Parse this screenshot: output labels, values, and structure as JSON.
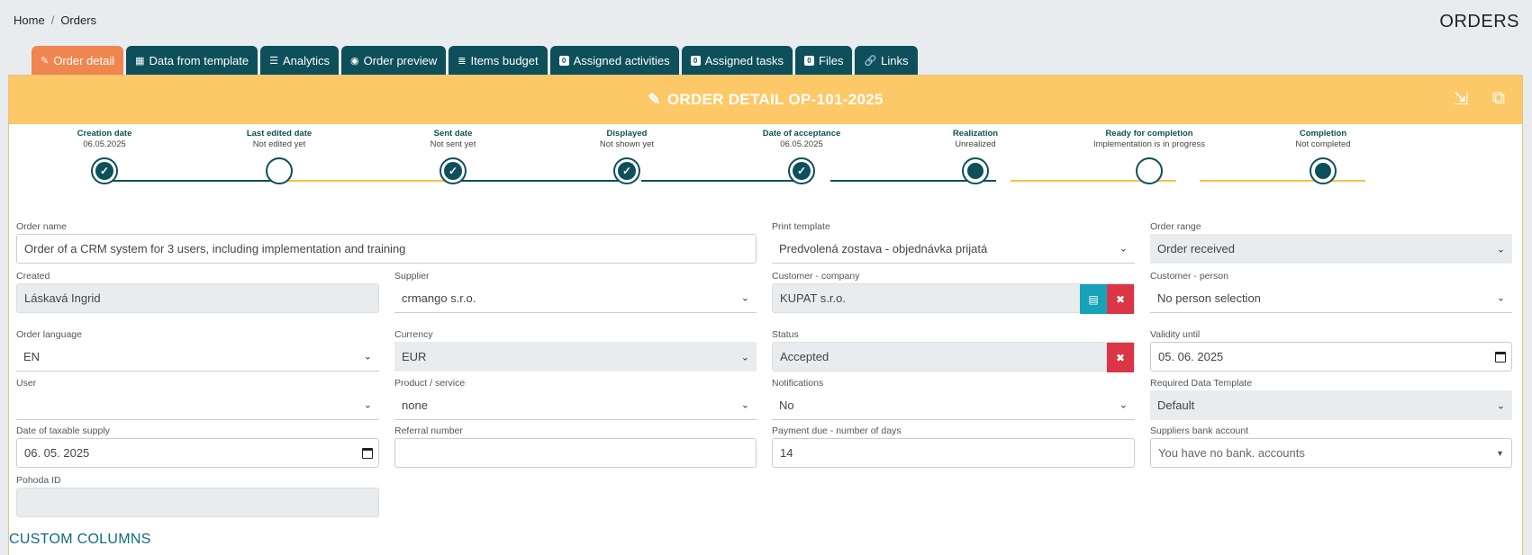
{
  "breadcrumb": {
    "home": "Home",
    "current": "Orders"
  },
  "page_title": "ORDERS",
  "tabs": [
    {
      "label": "Order detail",
      "icon": "edit-icon"
    },
    {
      "label": "Data from template",
      "icon": "table-icon"
    },
    {
      "label": "Analytics",
      "icon": "list-icon"
    },
    {
      "label": "Order preview",
      "icon": "eye-icon"
    },
    {
      "label": "Items budget",
      "icon": "database-icon"
    },
    {
      "label": "Assigned activities",
      "icon": "badge-icon"
    },
    {
      "label": "Assigned tasks",
      "icon": "badge-icon"
    },
    {
      "label": "Files",
      "icon": "badge-icon"
    },
    {
      "label": "Links",
      "icon": "link-icon"
    }
  ],
  "panel": {
    "title": "ORDER DETAIL OP-101-2025"
  },
  "timeline": [
    {
      "title": "Creation date",
      "sub": "06.05.2025",
      "state": "done"
    },
    {
      "title": "Last edited date",
      "sub": "Not edited yet",
      "state": "empty"
    },
    {
      "title": "Sent date",
      "sub": "Not sent yet",
      "state": "done"
    },
    {
      "title": "Displayed",
      "sub": "Not shown yet",
      "state": "done"
    },
    {
      "title": "Date of acceptance",
      "sub": "06.05.2025",
      "state": "done"
    },
    {
      "title": "Realization",
      "sub": "Unrealized",
      "state": "current"
    },
    {
      "title": "Ready for completion",
      "sub": "Implementation is in progress",
      "state": "empty"
    },
    {
      "title": "Completion",
      "sub": "Not completed",
      "state": "current"
    }
  ],
  "form": {
    "order_name": {
      "label": "Order name",
      "value": "Order of a CRM system for 3 users, including implementation and training"
    },
    "print_template": {
      "label": "Print template",
      "value": "Predvolená zostava - objednávka prijatá"
    },
    "order_range": {
      "label": "Order range",
      "value": "Order received"
    },
    "created": {
      "label": "Created",
      "value": "Láskavá Ingrid"
    },
    "supplier": {
      "label": "Supplier",
      "value": "crmango s.r.o."
    },
    "customer_company": {
      "label": "Customer - company",
      "value": "KUPAT s.r.o."
    },
    "customer_person": {
      "label": "Customer - person",
      "value": "No person selection"
    },
    "order_language": {
      "label": "Order language",
      "value": "EN"
    },
    "currency": {
      "label": "Currency",
      "value": "EUR"
    },
    "status": {
      "label": "Status",
      "value": "Accepted"
    },
    "validity_until": {
      "label": "Validity until",
      "value": "05. 06. 2025"
    },
    "user": {
      "label": "User",
      "value": ""
    },
    "product_service": {
      "label": "Product / service",
      "value": "none"
    },
    "notifications": {
      "label": "Notifications",
      "value": "No"
    },
    "required_template": {
      "label": "Required Data Template",
      "value": "Default"
    },
    "taxable_supply": {
      "label": "Date of taxable supply",
      "value": "06. 05. 2025"
    },
    "referral_number": {
      "label": "Referral number",
      "value": ""
    },
    "payment_due": {
      "label": "Payment due - number of days",
      "value": "14"
    },
    "bank_account": {
      "label": "Suppliers bank account",
      "value": "You have no bank. accounts"
    },
    "pohoda_id": {
      "label": "Pohoda ID",
      "value": ""
    }
  },
  "custom_columns": "CUSTOM COLUMNS",
  "colors": {
    "accent": "#f0864f",
    "header": "#fdc867",
    "teal": "#0d4f5a",
    "line_done": "#0d4f5a",
    "line_pending": "#f5c04a",
    "danger": "#dc3545",
    "info": "#17a2b8"
  }
}
